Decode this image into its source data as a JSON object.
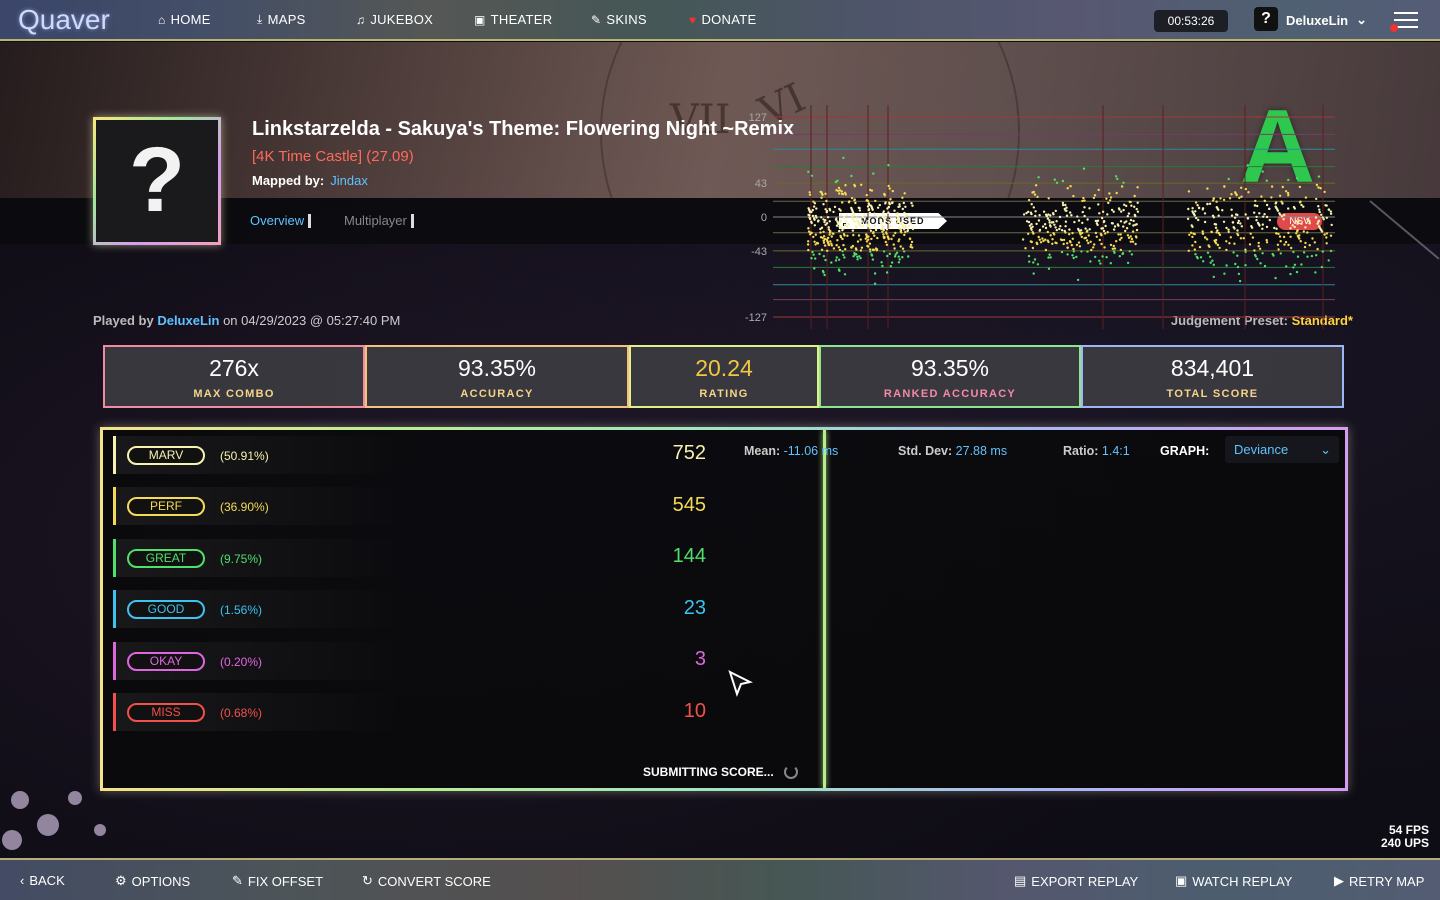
{
  "nav": {
    "logo": "Quaver",
    "items": [
      {
        "label": "HOME",
        "icon": "home-icon",
        "glyph": "⌂"
      },
      {
        "label": "MAPS",
        "icon": "download-icon",
        "glyph": "⤓"
      },
      {
        "label": "JUKEBOX",
        "icon": "music-icon",
        "glyph": "♫"
      },
      {
        "label": "THEATER",
        "icon": "camera-icon",
        "glyph": "▣"
      },
      {
        "label": "SKINS",
        "icon": "brush-icon",
        "glyph": "✎"
      },
      {
        "label": "DONATE",
        "icon": "heart-icon",
        "glyph": "♥"
      }
    ],
    "clock": "00:53:26",
    "avatar": "?",
    "username": "DeluxeLin"
  },
  "song": {
    "title": "Linkstarzelda - Sakuya's Theme: Flowering Night ~Remix",
    "difficulty": "[4K Time Castle] (27.09)",
    "mapped_by_label": "Mapped by:",
    "mapper": "Jindax",
    "cover_placeholder": "?",
    "grade": "A"
  },
  "tabs": [
    {
      "label": "Overview",
      "active": true
    },
    {
      "label": "Multiplayer",
      "active": false
    }
  ],
  "mods_label": "MODS USED",
  "mod_badge": "NSV",
  "played": {
    "prefix": "Played by",
    "player": "DeluxeLin",
    "date": "on 04/29/2023 @ 05:27:40 PM"
  },
  "preset": {
    "label": "Judgement Preset:",
    "value": "Standard*"
  },
  "stats": [
    {
      "value": "276x",
      "label": "MAX COMBO",
      "color": "#f6d58a",
      "border": "#f28aa0"
    },
    {
      "value": "93.35%",
      "label": "ACCURACY",
      "color": "#f6d58a",
      "border": "#f4c27a"
    },
    {
      "value": "20.24",
      "label": "RATING",
      "color": "#f6d58a",
      "border": "#e4ee88"
    },
    {
      "value": "93.35%",
      "label": "RANKED ACCURACY",
      "color": "#f58aa8",
      "border": "#8ee58e"
    },
    {
      "value": "834,401",
      "label": "TOTAL SCORE",
      "color": "#f6d58a",
      "border": "#9fb6f5"
    }
  ],
  "judgements": [
    {
      "name": "MARV",
      "pct": "(50.91%)",
      "count": "752",
      "color": "#f7f2b0"
    },
    {
      "name": "PERF",
      "pct": "(36.90%)",
      "count": "545",
      "color": "#f5da55"
    },
    {
      "name": "GREAT",
      "pct": "(9.75%)",
      "count": "144",
      "color": "#4fe06a"
    },
    {
      "name": "GOOD",
      "pct": "(1.56%)",
      "count": "23",
      "color": "#3cc3f0"
    },
    {
      "name": "OKAY",
      "pct": "(0.20%)",
      "count": "3",
      "color": "#e066e0"
    },
    {
      "name": "MISS",
      "pct": "(0.68%)",
      "count": "10",
      "color": "#f2504a"
    }
  ],
  "submitting": "SUBMITTING SCORE...",
  "graph": {
    "mean_label": "Mean:",
    "mean": "-11.06 ms",
    "std_label": "Std. Dev:",
    "std": "27.88 ms",
    "ratio_label": "Ratio:",
    "ratio": "1.4:1",
    "graph_label": "GRAPH:",
    "selected": "Deviance",
    "y_ticks": [
      "127",
      "43",
      "0",
      "-43",
      "-127"
    ]
  },
  "fps": {
    "fps": "54 FPS",
    "ups": "240 UPS"
  },
  "bottom": [
    {
      "label": "BACK",
      "glyph": "‹",
      "icon": "back-icon"
    },
    {
      "label": "OPTIONS",
      "glyph": "⚙",
      "icon": "gear-icon"
    },
    {
      "label": "FIX OFFSET",
      "glyph": "✎",
      "icon": "wrench-icon"
    },
    {
      "label": "CONVERT SCORE",
      "glyph": "↻",
      "icon": "refresh-icon"
    },
    {
      "label": "EXPORT REPLAY",
      "glyph": "▤",
      "icon": "export-icon"
    },
    {
      "label": "WATCH REPLAY",
      "glyph": "▣",
      "icon": "camera-icon"
    },
    {
      "label": "RETRY MAP",
      "glyph": "▶",
      "icon": "play-icon"
    }
  ]
}
